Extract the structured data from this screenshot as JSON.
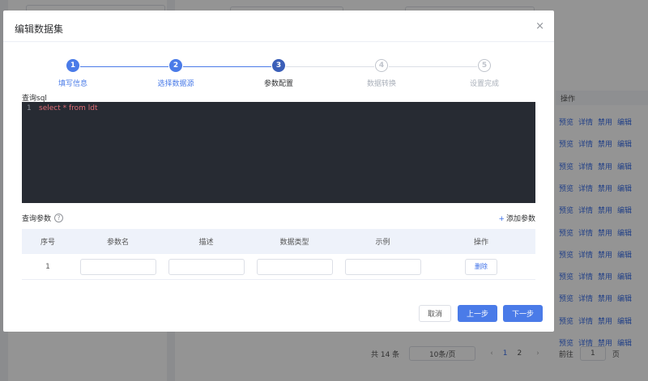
{
  "background": {
    "table_header": "操作",
    "row_actions": [
      "预览",
      "详情",
      "禁用",
      "编辑"
    ],
    "row_count": 11,
    "pager": {
      "total": "共 14 条",
      "page_size": "10条/页",
      "prev": "‹",
      "pages": [
        "1",
        "2"
      ],
      "active_page": "1",
      "next": "›",
      "goto_label": "前往",
      "goto_value": "1",
      "page_unit": "页"
    }
  },
  "modal": {
    "title": "编辑数据集",
    "close": "×",
    "steps": [
      {
        "num": "1",
        "label": "填写信息",
        "state": "done"
      },
      {
        "num": "2",
        "label": "选择数据源",
        "state": "done"
      },
      {
        "num": "3",
        "label": "参数配置",
        "state": "active"
      },
      {
        "num": "4",
        "label": "数据转换",
        "state": "pending"
      },
      {
        "num": "5",
        "label": "设置完成",
        "state": "pending"
      }
    ],
    "sql_label": "查询sql",
    "editor": {
      "line_number": "1",
      "code": "select * from ldt"
    },
    "params_label": "查询参数",
    "help_icon": "?",
    "add_param": {
      "plus": "+",
      "label": "添加参数"
    },
    "table": {
      "headers": [
        "序号",
        "参数名",
        "描述",
        "数据类型",
        "示例",
        "操作"
      ],
      "rows": [
        {
          "index": "1",
          "name": "",
          "desc": "",
          "type": "",
          "example": "",
          "action": "删除"
        }
      ]
    },
    "buttons": {
      "cancel": "取消",
      "prev": "上一步",
      "next": "下一步"
    }
  },
  "colors": {
    "primary": "#4a7be8",
    "done_step": "#4a7be8",
    "active_step": "#3b5fb8",
    "pending_step": "#c0c4cc",
    "editor_bg": "#272b33",
    "code_text": "#e06c75"
  }
}
